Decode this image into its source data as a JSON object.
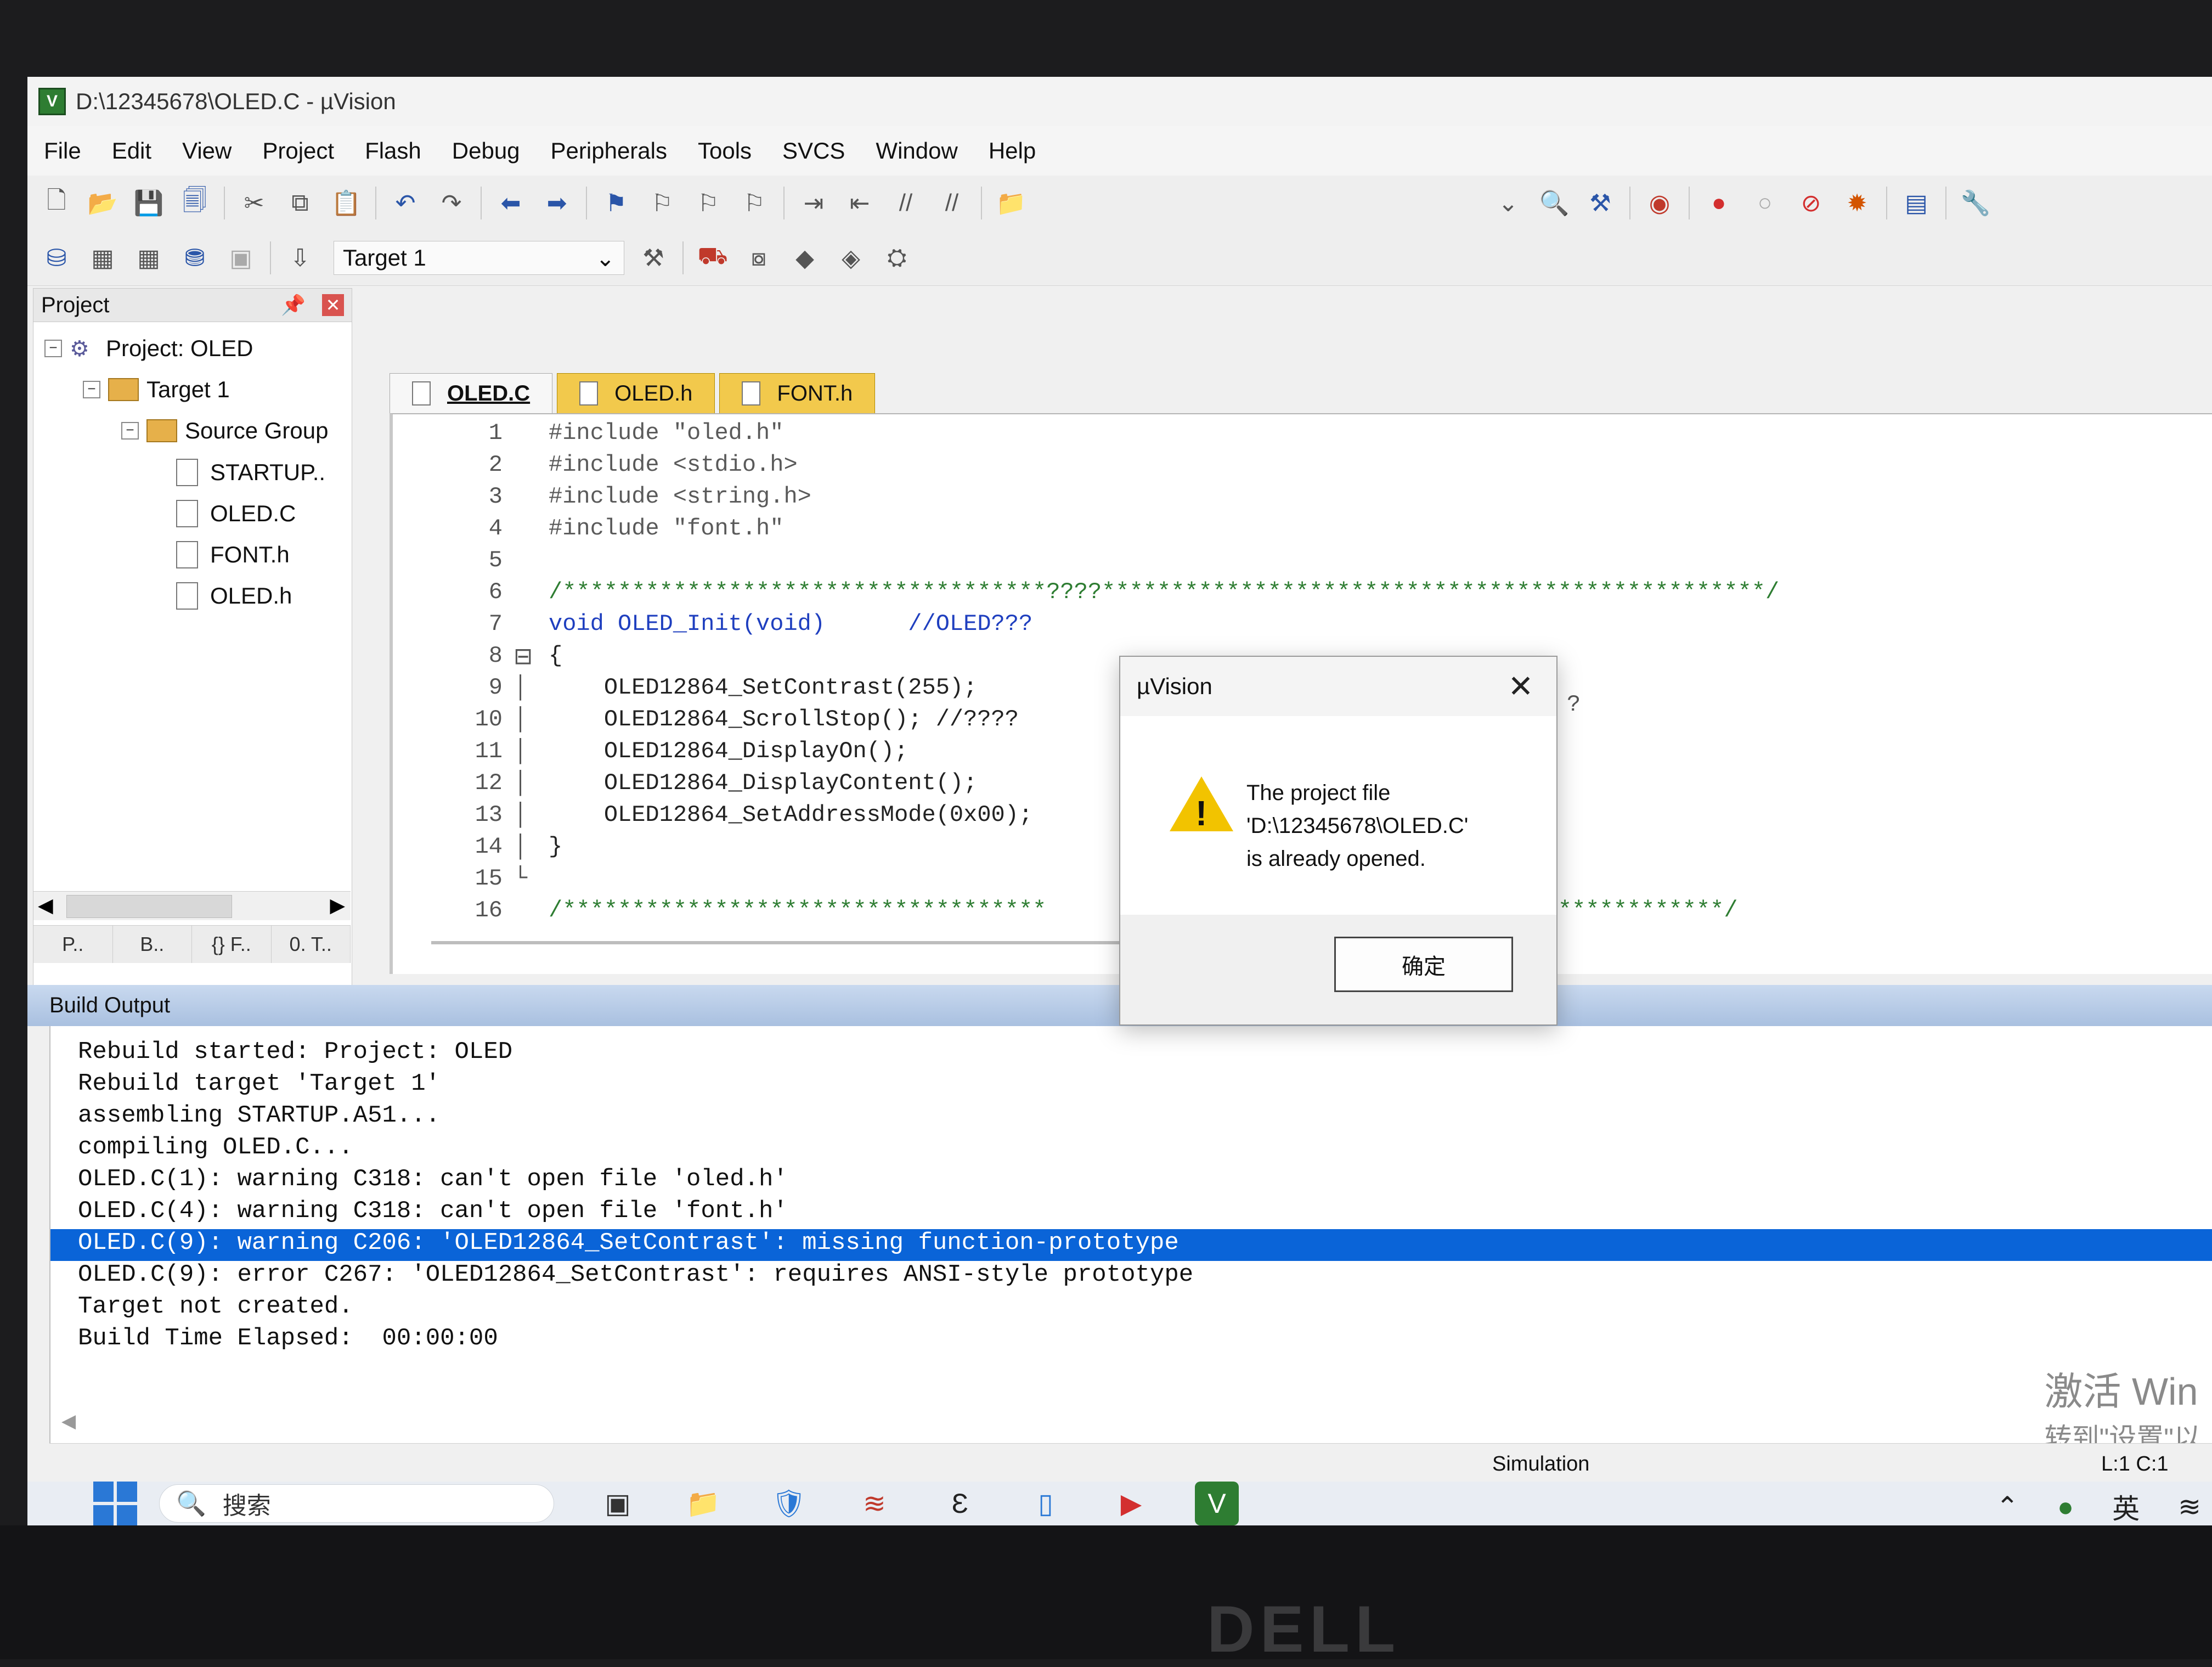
{
  "window": {
    "title": "D:\\12345678\\OLED.C - µVision",
    "app_icon": "V"
  },
  "menu": [
    "File",
    "Edit",
    "View",
    "Project",
    "Flash",
    "Debug",
    "Peripherals",
    "Tools",
    "SVCS",
    "Window",
    "Help"
  ],
  "toolbar": {
    "target": "Target 1"
  },
  "project_panel": {
    "title": "Project",
    "tree": [
      {
        "label": "Project: OLED",
        "depth": 0
      },
      {
        "label": "Target 1",
        "depth": 1
      },
      {
        "label": "Source Group",
        "depth": 2
      },
      {
        "label": "STARTUP..",
        "depth": 3
      },
      {
        "label": "OLED.C",
        "depth": 3
      },
      {
        "label": "FONT.h",
        "depth": 3
      },
      {
        "label": "OLED.h",
        "depth": 3
      }
    ],
    "tabs": [
      "P..",
      "B..",
      "{} F..",
      "0. T.."
    ]
  },
  "editor": {
    "tabs": [
      "OLED.C",
      "OLED.h",
      "FONT.h"
    ],
    "lines": [
      {
        "n": "1",
        "text": "#include \"oled.h\""
      },
      {
        "n": "2",
        "text": "#include <stdio.h>"
      },
      {
        "n": "3",
        "text": "#include <string.h>"
      },
      {
        "n": "4",
        "text": "#include \"font.h\""
      },
      {
        "n": "5",
        "text": ""
      },
      {
        "n": "6",
        "text": "/***********************************????************************************************/"
      },
      {
        "n": "7",
        "text": "void OLED_Init(void)      //OLED???"
      },
      {
        "n": "8",
        "text": "{"
      },
      {
        "n": "9",
        "text": "    OLED12864_SetContrast(255);"
      },
      {
        "n": "10",
        "text": "    OLED12864_ScrollStop(); //????"
      },
      {
        "n": "11",
        "text": "    OLED12864_DisplayOn();"
      },
      {
        "n": "12",
        "text": "    OLED12864_DisplayContent();"
      },
      {
        "n": "13",
        "text": "    OLED12864_SetAddressMode(0x00);"
      },
      {
        "n": "14",
        "text": "}"
      },
      {
        "n": "15",
        "text": ""
      },
      {
        "n": "16",
        "text": "/***********************************                          ***********************/"
      }
    ],
    "stray_char": "?"
  },
  "build_output": {
    "title": "Build Output",
    "lines": [
      "Rebuild started: Project: OLED",
      "Rebuild target 'Target 1'",
      "assembling STARTUP.A51...",
      "compiling OLED.C...",
      "OLED.C(1): warning C318: can't open file 'oled.h'",
      "OLED.C(4): warning C318: can't open file 'font.h'",
      "OLED.C(9): warning C206: 'OLED12864_SetContrast': missing function-prototype",
      "OLED.C(9): error C267: 'OLED12864_SetContrast': requires ANSI-style prototype",
      "Target not created.",
      "Build Time Elapsed:  00:00:00"
    ],
    "highlighted_index": 6
  },
  "status": {
    "mode": "Simulation",
    "position": "L:1 C:1"
  },
  "watermark": {
    "line1": "激活 Win",
    "line2": "转到\"设置\"以"
  },
  "dialog": {
    "title": "µVision",
    "message_lines": [
      "The project file",
      "'D:\\12345678\\OLED.C'",
      "is already opened."
    ],
    "ok_label": "确定"
  },
  "taskbar": {
    "search_placeholder": "搜索",
    "ime": "英"
  },
  "device_brand": "DELL",
  "colors": {
    "selection": "#0a64d8",
    "build_header": "#b5cbe8",
    "keyword": "#1f3fbf",
    "comment": "#2e7d32"
  }
}
